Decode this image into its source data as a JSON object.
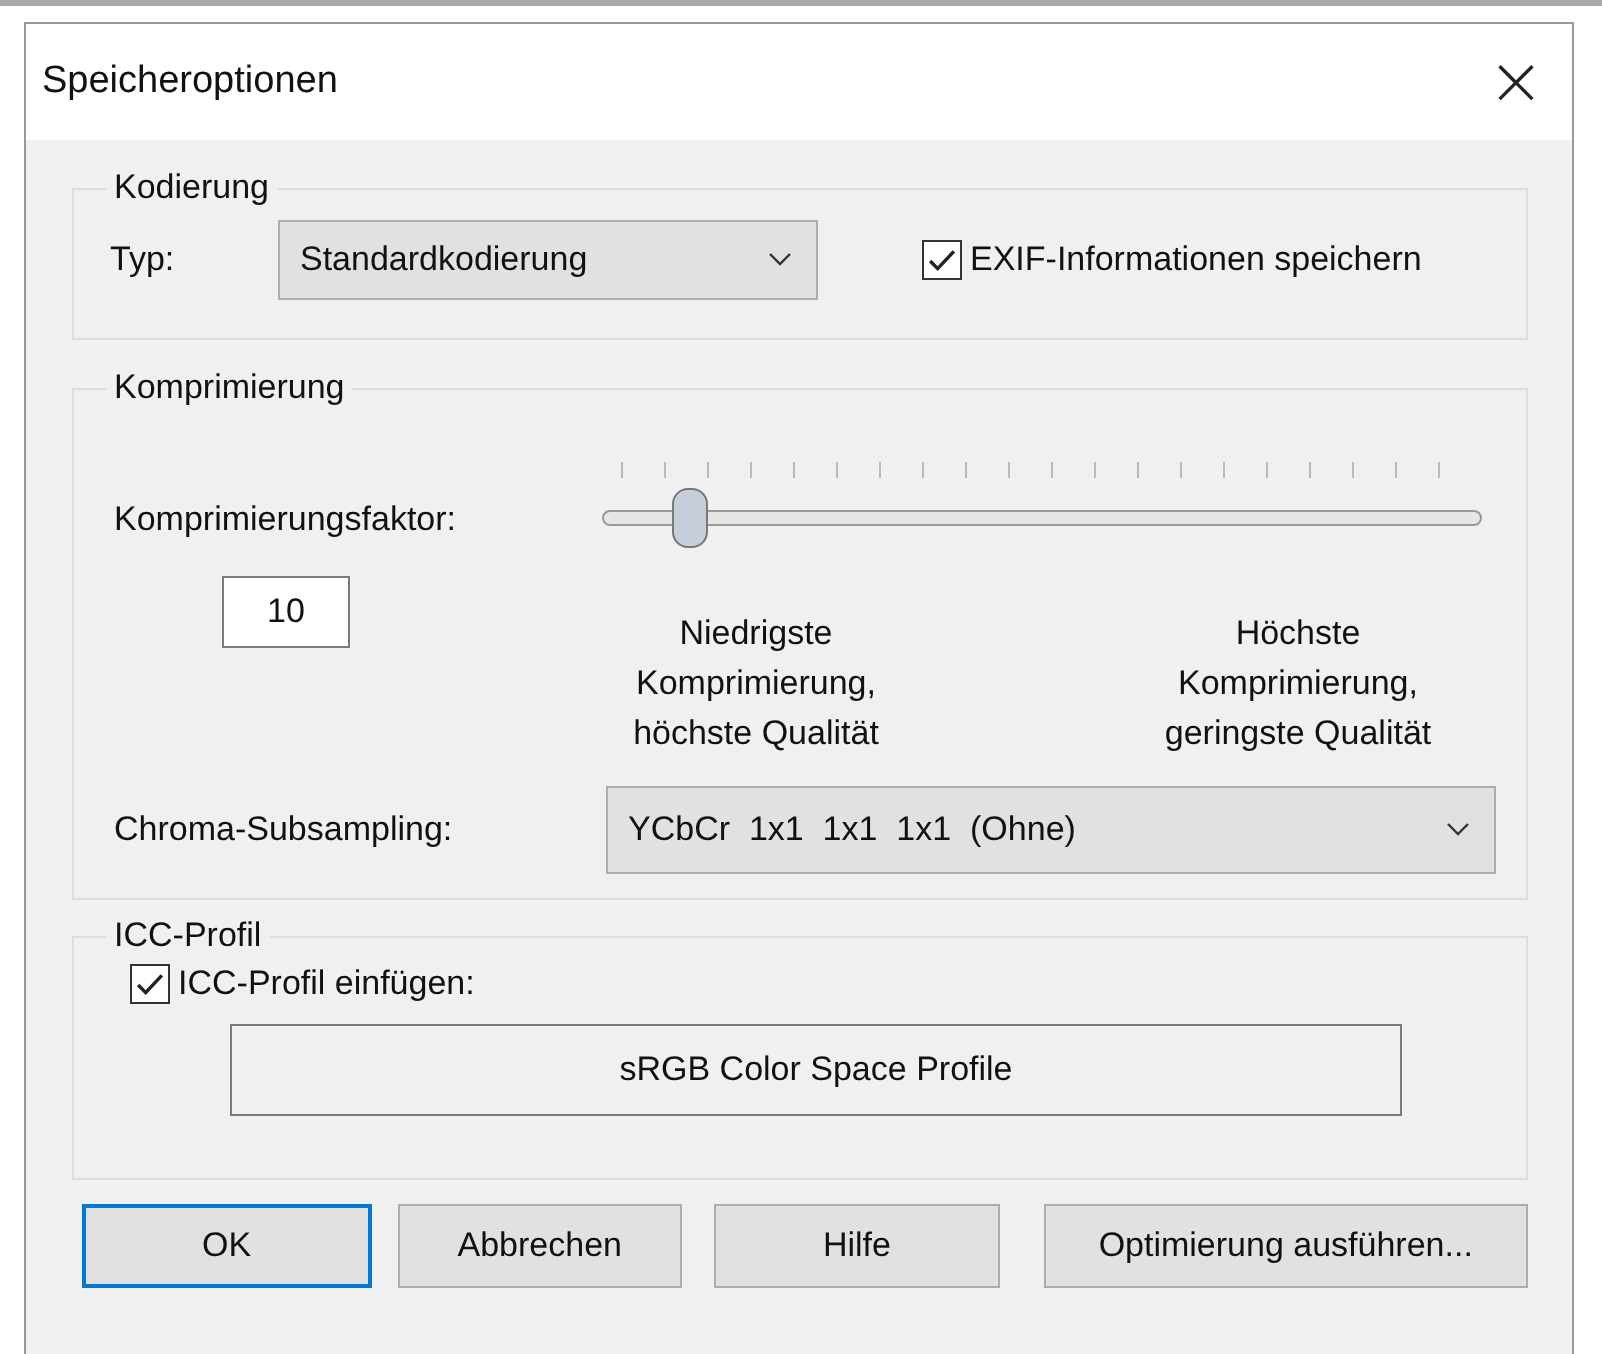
{
  "window": {
    "title": "Speicheroptionen",
    "close": "×"
  },
  "encoding": {
    "legend": "Kodierung",
    "type_label": "Typ:",
    "type_value": "Standardkodierung",
    "exif": {
      "label": "EXIF-Informationen speichern",
      "checked": true
    }
  },
  "compression": {
    "legend": "Komprimierung",
    "factor_label": "Komprimierungsfaktor:",
    "slider": {
      "level": 0.1
    },
    "factor_value": "10",
    "low_caption": "Niedrigste\nKomprimierung,\nhöchste Qualität",
    "high_caption": "Höchste\nKomprimierung,\ngeringste Qualität",
    "chroma_label": "Chroma-Subsampling:",
    "chroma_value": "YCbCr  1x1  1x1  1x1  (Ohne)"
  },
  "icc": {
    "legend": "ICC-Profil",
    "embed": {
      "label": "ICC-Profil einfügen:",
      "checked": true
    },
    "profile_button": "sRGB Color Space Profile"
  },
  "buttons": [
    {
      "label": "OK",
      "focused": true
    },
    {
      "label": "Abbrechen",
      "focused": false
    },
    {
      "label": "Hilfe",
      "focused": false
    },
    {
      "label": "Optimierung ausführen...",
      "focused": false
    }
  ]
}
